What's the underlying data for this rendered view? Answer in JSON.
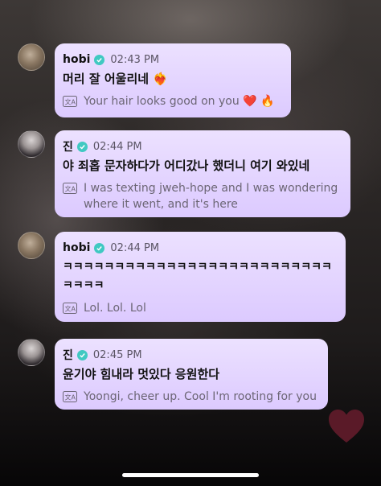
{
  "messages": [
    {
      "user": "hobi",
      "time": "02:43 PM",
      "text": "머리 잘 어울리네 ❤️‍🔥",
      "translation": "Your hair looks good on you ❤️ 🔥"
    },
    {
      "user": "진",
      "time": "02:44 PM",
      "text": "야 죄홉 문자하다가 어디갔나 했더니 여기 와있네",
      "translation": "I was texting jweh-hope and I was wondering where it went, and it's here"
    },
    {
      "user": "hobi",
      "time": "02:44 PM",
      "text": "ㅋㅋㅋㅋㅋㅋㅋㅋㅋㅋㅋㅋㅋㅋㅋㅋㅋㅋㅋㅋㅋㅋㅋㅋㅋㅋㅋㅋㅋㅋ",
      "translation": "Lol. Lol. Lol"
    },
    {
      "user": "진",
      "time": "02:45 PM",
      "text": "윤기야 힘내라 멋있다 응원한다",
      "translation": "Yoongi, cheer up. Cool I'm rooting for you"
    }
  ],
  "colors": {
    "bubble": "#dccaff",
    "verified": "#40c9c2",
    "floating_heart": "#5a1a28"
  },
  "icons": {
    "verified": "verified-badge-icon",
    "translate": "translate-icon",
    "floating_reaction": "heart-icon"
  }
}
